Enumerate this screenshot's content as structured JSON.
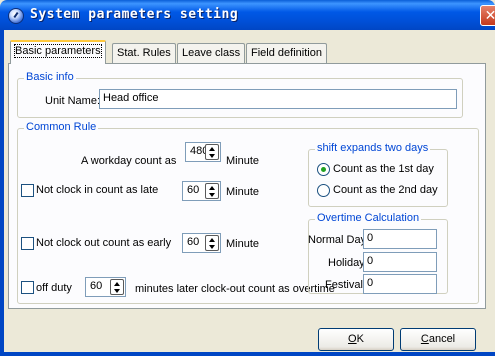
{
  "window": {
    "title": "System parameters setting",
    "close_glyph": "✕"
  },
  "tabs": [
    {
      "label": "Basic parameters",
      "active": true
    },
    {
      "label": "Stat. Rules",
      "active": false
    },
    {
      "label": "Leave class",
      "active": false
    },
    {
      "label": "Field definition",
      "active": false
    }
  ],
  "basic_info": {
    "group_label": "Basic info",
    "unit_name_label": "Unit Name:",
    "unit_name_value": "Head office"
  },
  "common_rule": {
    "group_label": "Common Rule",
    "workday_label": "A workday count as",
    "workday_value": "480",
    "workday_unit": "Minute",
    "not_clock_in_label": "Not clock in count as late",
    "not_clock_in_checked": false,
    "not_clock_in_value": "60",
    "not_clock_in_unit": "Minute",
    "not_clock_out_label": "Not clock out count as early",
    "not_clock_out_checked": false,
    "not_clock_out_value": "60",
    "not_clock_out_unit": "Minute",
    "off_duty_label": "off duty",
    "off_duty_checked": false,
    "off_duty_value": "60",
    "off_duty_suffix": "minutes later clock-out count as overtime"
  },
  "shift_expands": {
    "group_label": "shift expands two days",
    "options": [
      {
        "label": "Count as the 1st day",
        "checked": true
      },
      {
        "label": "Count as the 2nd day",
        "checked": false
      }
    ]
  },
  "overtime": {
    "group_label": "Overtime Calculation",
    "normal_day_label": "Normal Day",
    "normal_day_value": "0",
    "holiday_label": "Holiday",
    "holiday_value": "0",
    "festival_label": "Festival",
    "festival_value": "0"
  },
  "buttons": {
    "ok_mnemonic": "O",
    "ok_rest": "K",
    "cancel_mnemonic": "C",
    "cancel_rest": "ancel"
  }
}
